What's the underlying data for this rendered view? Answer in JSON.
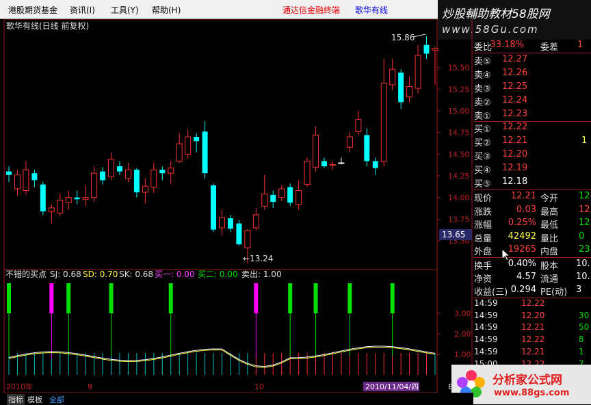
{
  "menu": {
    "items": [
      "港股期货基金",
      "资讯(I)",
      "工具(Y)",
      "帮助(H)"
    ],
    "link_red": "通达信金融终端",
    "link_blue": "歌华有线"
  },
  "banner": {
    "line1": "炒股輔助教材58股网",
    "line2": "www.58Gu.com"
  },
  "chart": {
    "title": "歌华有线(日线 前复权)",
    "high_label": "15.86",
    "low_label": "←13.24",
    "current_price_tag": "13.65",
    "y_ticks": [
      "15.50",
      "15.25",
      "15.00",
      "14.75",
      "14.50",
      "14.25",
      "14.00",
      "13.75",
      "13.50"
    ],
    "indicator_header": {
      "name": "不错的买点",
      "sj": "SJ: 0.68",
      "sd": "SD: 0.70",
      "sk": "SK: 0.68",
      "buy1": "买一: 0.00",
      "buy2": "买二: 0.00",
      "sell": "卖出: 1.00"
    },
    "ind_y_ticks": [
      "3.00",
      "2.00",
      "1.00"
    ],
    "x_labels": [
      "2010年",
      "9",
      "10",
      "2010/11/04/四",
      "E"
    ]
  },
  "chart_data": {
    "type": "candlestick",
    "title": "歌华有线(日线 前复权)",
    "y_range": [
      13.2,
      15.9
    ],
    "annotations": {
      "high": 15.86,
      "low": 13.24
    },
    "candles": [
      {
        "o": 14.3,
        "c": 14.26,
        "h": 14.36,
        "l": 14.18,
        "color": "cyan"
      },
      {
        "o": 14.1,
        "c": 14.26,
        "h": 14.32,
        "l": 14.02,
        "color": "red"
      },
      {
        "o": 14.08,
        "c": 14.32,
        "h": 14.42,
        "l": 14.03,
        "color": "red"
      },
      {
        "o": 14.28,
        "c": 14.2,
        "h": 14.32,
        "l": 14.12,
        "color": "cyan"
      },
      {
        "o": 14.15,
        "c": 13.84,
        "h": 14.18,
        "l": 13.8,
        "color": "cyan"
      },
      {
        "o": 13.84,
        "c": 13.88,
        "h": 13.92,
        "l": 13.7,
        "color": "red"
      },
      {
        "o": 13.82,
        "c": 13.97,
        "h": 14.05,
        "l": 13.78,
        "color": "red"
      },
      {
        "o": 13.94,
        "c": 14.0,
        "h": 14.08,
        "l": 13.86,
        "color": "red"
      },
      {
        "o": 14.0,
        "c": 13.98,
        "h": 14.08,
        "l": 13.92,
        "color": "cyan"
      },
      {
        "o": 13.98,
        "c": 14.0,
        "h": 14.14,
        "l": 13.9,
        "color": "red"
      },
      {
        "o": 14.0,
        "c": 14.28,
        "h": 14.36,
        "l": 13.95,
        "color": "red"
      },
      {
        "o": 14.3,
        "c": 14.2,
        "h": 14.35,
        "l": 14.15,
        "color": "cyan"
      },
      {
        "o": 14.24,
        "c": 14.44,
        "h": 14.52,
        "l": 14.2,
        "color": "red"
      },
      {
        "o": 14.36,
        "c": 14.3,
        "h": 14.42,
        "l": 14.26,
        "color": "cyan"
      },
      {
        "o": 14.22,
        "c": 14.32,
        "h": 14.4,
        "l": 14.18,
        "color": "red"
      },
      {
        "o": 14.32,
        "c": 14.06,
        "h": 14.34,
        "l": 14.0,
        "color": "cyan"
      },
      {
        "o": 14.06,
        "c": 14.13,
        "h": 14.22,
        "l": 13.93,
        "color": "red"
      },
      {
        "o": 14.12,
        "c": 14.32,
        "h": 14.4,
        "l": 14.05,
        "color": "red"
      },
      {
        "o": 14.32,
        "c": 14.28,
        "h": 14.36,
        "l": 14.2,
        "color": "cyan"
      },
      {
        "o": 14.28,
        "c": 14.34,
        "h": 14.42,
        "l": 14.16,
        "color": "red"
      },
      {
        "o": 14.42,
        "c": 14.62,
        "h": 14.74,
        "l": 14.4,
        "color": "red"
      },
      {
        "o": 14.5,
        "c": 14.7,
        "h": 14.78,
        "l": 14.45,
        "color": "red"
      },
      {
        "o": 14.7,
        "c": 14.65,
        "h": 14.74,
        "l": 14.52,
        "color": "cyan"
      },
      {
        "o": 14.76,
        "c": 14.28,
        "h": 14.88,
        "l": 14.22,
        "color": "cyan"
      },
      {
        "o": 14.14,
        "c": 13.63,
        "h": 14.16,
        "l": 13.6,
        "color": "cyan"
      },
      {
        "o": 13.65,
        "c": 13.77,
        "h": 13.86,
        "l": 13.56,
        "color": "red"
      },
      {
        "o": 13.76,
        "c": 13.64,
        "h": 13.8,
        "l": 13.6,
        "color": "cyan"
      },
      {
        "o": 13.7,
        "c": 13.46,
        "h": 13.74,
        "l": 13.44,
        "color": "cyan"
      },
      {
        "o": 13.42,
        "c": 13.62,
        "h": 13.64,
        "l": 13.24,
        "color": "red"
      },
      {
        "o": 13.65,
        "c": 13.8,
        "h": 13.88,
        "l": 13.62,
        "color": "red"
      },
      {
        "o": 13.9,
        "c": 14.04,
        "h": 14.26,
        "l": 13.86,
        "color": "red"
      },
      {
        "o": 14.03,
        "c": 13.95,
        "h": 14.08,
        "l": 13.88,
        "color": "cyan"
      },
      {
        "o": 14.0,
        "c": 14.1,
        "h": 14.14,
        "l": 13.96,
        "color": "red"
      },
      {
        "o": 14.12,
        "c": 13.94,
        "h": 14.16,
        "l": 13.9,
        "color": "cyan"
      },
      {
        "o": 13.92,
        "c": 14.08,
        "h": 14.2,
        "l": 13.86,
        "color": "red"
      },
      {
        "o": 14.15,
        "c": 14.42,
        "h": 14.46,
        "l": 14.12,
        "color": "red"
      },
      {
        "o": 14.35,
        "c": 14.72,
        "h": 14.82,
        "l": 14.3,
        "color": "red"
      },
      {
        "o": 14.42,
        "c": 14.36,
        "h": 14.46,
        "l": 14.34,
        "color": "cyan"
      },
      {
        "o": 14.38,
        "c": 14.38,
        "h": 14.42,
        "l": 14.32,
        "color": "red"
      },
      {
        "o": 14.4,
        "c": 14.4,
        "h": 14.46,
        "l": 14.38,
        "color": "white"
      },
      {
        "o": 14.58,
        "c": 14.7,
        "h": 14.76,
        "l": 14.52,
        "color": "red"
      },
      {
        "o": 14.76,
        "c": 14.9,
        "h": 15.0,
        "l": 14.72,
        "color": "red"
      },
      {
        "o": 14.72,
        "c": 14.42,
        "h": 14.8,
        "l": 14.36,
        "color": "cyan"
      },
      {
        "o": 14.42,
        "c": 14.34,
        "h": 14.46,
        "l": 14.26,
        "color": "cyan"
      },
      {
        "o": 14.42,
        "c": 15.32,
        "h": 15.6,
        "l": 14.36,
        "color": "red"
      },
      {
        "o": 15.3,
        "c": 15.48,
        "h": 15.6,
        "l": 15.24,
        "color": "red"
      },
      {
        "o": 15.44,
        "c": 15.1,
        "h": 15.48,
        "l": 15.02,
        "color": "cyan"
      },
      {
        "o": 15.16,
        "c": 15.28,
        "h": 15.4,
        "l": 15.1,
        "color": "red"
      },
      {
        "o": 15.26,
        "c": 15.64,
        "h": 15.76,
        "l": 15.2,
        "color": "red"
      },
      {
        "o": 15.66,
        "c": 15.76,
        "h": 15.86,
        "l": 15.6,
        "color": "cyan"
      },
      {
        "o": 15.72,
        "c": 15.7,
        "h": 15.74,
        "l": 15.3,
        "color": "red"
      }
    ],
    "indicator": {
      "name": "不错的买点",
      "values": {
        "SJ": 0.68,
        "SD": 0.7,
        "SK": 0.68,
        "买一": 0.0,
        "买二": 0.0,
        "卖出": 1.0
      }
    }
  },
  "quote": {
    "wei_bi": {
      "label": "委比",
      "value": "33.18%",
      "label2": "委差",
      "value2": "1"
    },
    "asks": [
      {
        "label": "卖⑤",
        "price": "12.27"
      },
      {
        "label": "卖④",
        "price": "12.26"
      },
      {
        "label": "卖③",
        "price": "12.25"
      },
      {
        "label": "卖②",
        "price": "12.24"
      },
      {
        "label": "卖①",
        "price": "12.23"
      }
    ],
    "bids": [
      {
        "label": "买①",
        "price": "12.22",
        "vol": ""
      },
      {
        "label": "买②",
        "price": "12.21",
        "vol": "1"
      },
      {
        "label": "买③",
        "price": "12.20",
        "vol": ""
      },
      {
        "label": "买④",
        "price": "12.19",
        "vol": ""
      },
      {
        "label": "买⑤",
        "price": "12.18",
        "vol": ""
      }
    ],
    "stats": [
      {
        "l1": "现价",
        "v1": "12.21",
        "c1": "red",
        "l2": "今开",
        "v2": "12",
        "c2": "green"
      },
      {
        "l1": "涨跌",
        "v1": "0.03",
        "c1": "red",
        "l2": "最高",
        "v2": "12",
        "c2": "red"
      },
      {
        "l1": "涨幅",
        "v1": "0.25%",
        "c1": "red",
        "l2": "最低",
        "v2": "12",
        "c2": "green"
      },
      {
        "l1": "总量",
        "v1": "42492",
        "c1": "yellow",
        "l2": "量比",
        "v2": "0",
        "c2": "green"
      },
      {
        "l1": "外盘",
        "v1": "19265",
        "c1": "red",
        "l2": "内盘",
        "v2": "23",
        "c2": "green"
      }
    ],
    "fund": [
      {
        "l1": "换手",
        "v1": "0.40%",
        "l2": "股本",
        "v2": "10."
      },
      {
        "l1": "净资",
        "v1": "4.57",
        "l2": "流通",
        "v2": "10."
      },
      {
        "l1": "收益(三)",
        "v1": "0.294",
        "l2": "PE(动)",
        "v2": "3"
      }
    ],
    "ticks": [
      {
        "time": "14:59",
        "price": "12.22",
        "vol": ""
      },
      {
        "time": "14:59",
        "price": "12.20",
        "vol": "30"
      },
      {
        "time": "14:59",
        "price": "12.21",
        "vol": "50"
      },
      {
        "time": "14:59",
        "price": "12.22",
        "vol": "8"
      },
      {
        "time": "14:59",
        "price": "12.21",
        "vol": "1"
      },
      {
        "time": "15:00",
        "price": "12.22",
        "vol": "7"
      }
    ]
  },
  "watermark": {
    "cn": "分析家公式网",
    "url": "www.88gs.com"
  },
  "bottom_tabs": [
    "指标",
    "模板",
    "全部"
  ]
}
